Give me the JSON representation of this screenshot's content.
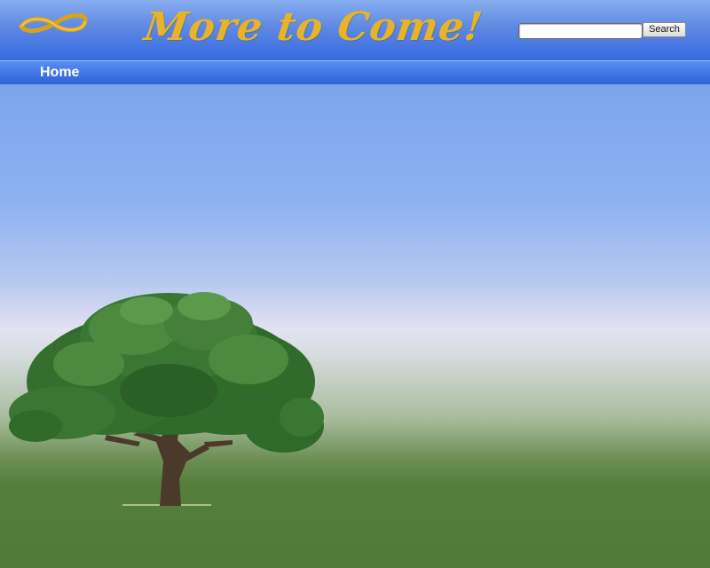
{
  "header": {
    "site_title": "More to Come!",
    "logo_icon": "infinity-ribbon-icon"
  },
  "search": {
    "placeholder": "",
    "value": "",
    "button_label": "Search"
  },
  "nav": {
    "items": [
      {
        "label": "Home"
      }
    ]
  },
  "decor": {
    "tree_icon": "tree-icon"
  },
  "colors": {
    "title_gold": "#e7b429",
    "header_blue": "#356ae0",
    "sky_blue": "#8eb2f1",
    "grass_green": "#4f7b38"
  }
}
